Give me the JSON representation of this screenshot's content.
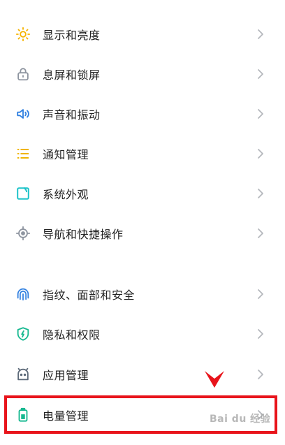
{
  "settings_items": [
    {
      "label": "显示和亮度",
      "icon": "sun-icon",
      "color": "#f5b400"
    },
    {
      "label": "息屏和锁屏",
      "icon": "lock-icon",
      "color": "#8e95a0"
    },
    {
      "label": "声音和振动",
      "icon": "speaker-icon",
      "color": "#2f7fe0"
    },
    {
      "label": "通知管理",
      "icon": "list-icon",
      "color": "#f0b400"
    },
    {
      "label": "系统外观",
      "icon": "appearance-icon",
      "color": "#1ec3c9"
    },
    {
      "label": "导航和快捷操作",
      "icon": "target-icon",
      "color": "#8e95a0"
    },
    {
      "label": "指纹、面部和安全",
      "icon": "fingerprint-icon",
      "color": "#2f7fe0"
    },
    {
      "label": "隐私和权限",
      "icon": "shield-icon",
      "color": "#16b890"
    },
    {
      "label": "应用管理",
      "icon": "android-icon",
      "color": "#5e6b7a"
    },
    {
      "label": "电量管理",
      "icon": "battery-icon",
      "color": "#16b890"
    }
  ],
  "watermark": "Bai du 经验",
  "accent_color": "#e8141b"
}
